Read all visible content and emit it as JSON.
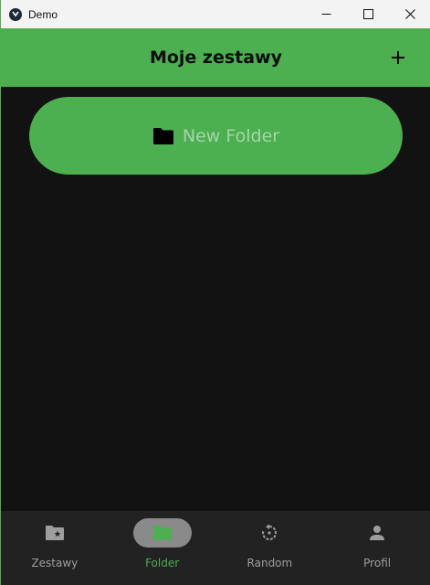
{
  "window": {
    "title": "Demo",
    "controls": [
      "minimize-icon",
      "maximize-icon",
      "close-icon"
    ]
  },
  "appbar": {
    "title": "Moje zestawy",
    "action_icon": "add-icon"
  },
  "content": {
    "folders": [
      {
        "label": "New Folder",
        "icon": "folder-icon"
      }
    ]
  },
  "bottom_nav": {
    "items": [
      {
        "label": "Zestawy",
        "icon": "folder-star-icon",
        "active": false
      },
      {
        "label": "Folder",
        "icon": "folder-icon",
        "active": true
      },
      {
        "label": "Random",
        "icon": "refresh-icon",
        "active": false
      },
      {
        "label": "Profil",
        "icon": "person-icon",
        "active": false
      }
    ]
  },
  "colors": {
    "accent": "#4caf50",
    "background": "#121212",
    "nav_background": "#222222",
    "nav_inactive": "#9e9e9e",
    "folder_label": "#a5d6a7"
  }
}
